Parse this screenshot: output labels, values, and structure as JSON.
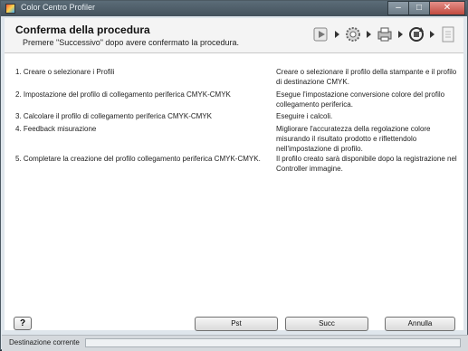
{
  "window": {
    "title": "Color Centro Profiler",
    "close_glyph": "✕",
    "minimize_glyph": "–",
    "maximize_glyph": "□"
  },
  "header": {
    "title": "Conferma della procedura",
    "subtitle": "Premere \"Successivo\" dopo avere confermato la procedura."
  },
  "steps_icons": [
    "play-icon",
    "gear-icon",
    "printer-icon",
    "sync-icon",
    "document-icon"
  ],
  "procedure": [
    {
      "step": "1. Creare o selezionare i Profili",
      "description": "Creare o selezionare il profilo della stampante e il profilo di destinazione CMYK."
    },
    {
      "step": "2. Impostazione del profilo di collegamento periferica CMYK-CMYK",
      "description": "Esegue l'impostazione conversione colore del profilo collegamento periferica."
    },
    {
      "step": "3. Calcolare il profilo di collegamento periferica CMYK-CMYK",
      "description": "Eseguire i calcoli."
    },
    {
      "step": "4. Feedback misurazione",
      "description": "Migliorare l'accuratezza della regolazione colore misurando il risultato prodotto e riflettendolo nell'impostazione di profilo."
    },
    {
      "step": "5. Completare la creazione del profilo collegamento periferica CMYK-CMYK.",
      "description": "Il profilo creato sarà disponibile dopo la registrazione nel Controller immagine."
    }
  ],
  "buttons": {
    "help": "?",
    "prev": "Pst",
    "next": "Succ",
    "cancel": "Annulla"
  },
  "status": {
    "label": "Destinazione corrente"
  }
}
